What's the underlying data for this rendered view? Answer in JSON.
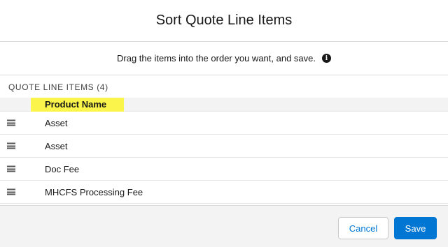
{
  "modal": {
    "title": "Sort Quote Line Items",
    "instructions": "Drag the items into the order you want, and save.",
    "info_icon": "i"
  },
  "section": {
    "label": "QUOTE LINE ITEMS (4)"
  },
  "table": {
    "column_header": "Product Name",
    "column_header_highlight": "#fbf44a",
    "rows": [
      {
        "label": "Asset"
      },
      {
        "label": "Asset"
      },
      {
        "label": "Doc Fee"
      },
      {
        "label": "MHCFS Processing Fee"
      }
    ]
  },
  "footer": {
    "cancel_label": "Cancel",
    "save_label": "Save"
  },
  "colors": {
    "brand": "#0176d3",
    "footer_bg": "#f3f3f3"
  }
}
